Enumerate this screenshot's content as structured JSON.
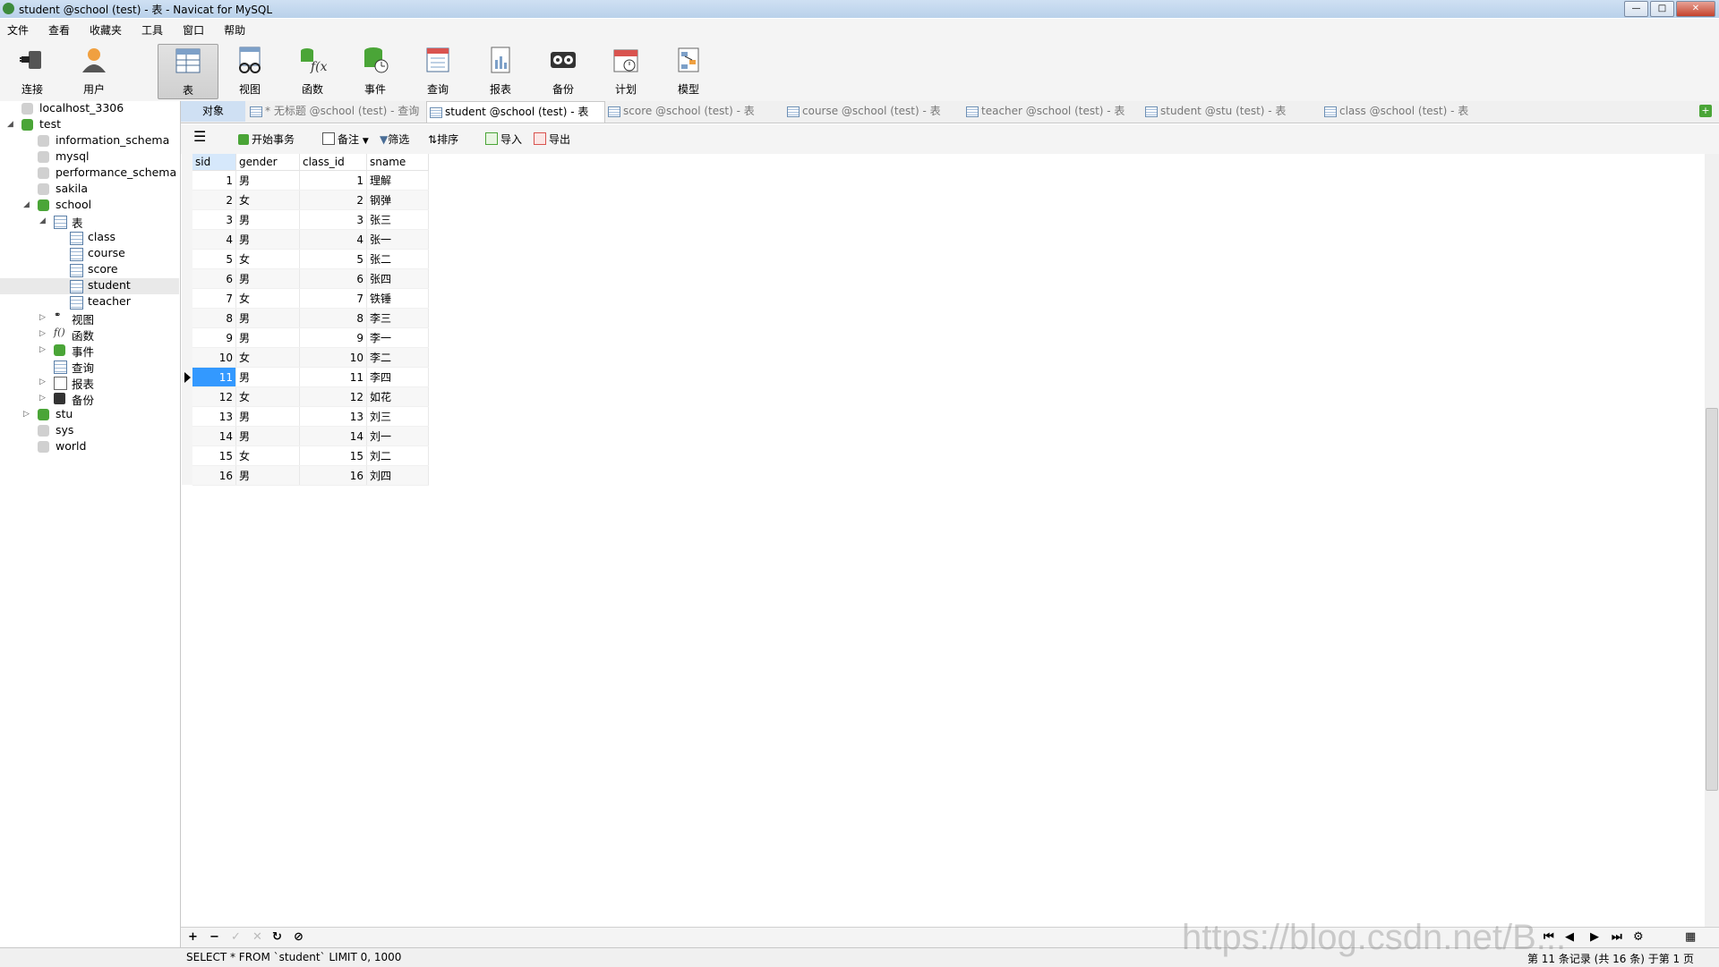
{
  "window": {
    "title": "student @school (test) - 表 - Navicat for MySQL"
  },
  "menu": [
    "文件",
    "查看",
    "收藏夹",
    "工具",
    "窗口",
    "帮助"
  ],
  "toolbar": [
    {
      "label": "连接",
      "icon": "connection-icon"
    },
    {
      "label": "用户",
      "icon": "user-icon"
    },
    {
      "label": "表",
      "icon": "table-icon",
      "active": true
    },
    {
      "label": "视图",
      "icon": "view-icon"
    },
    {
      "label": "函数",
      "icon": "function-icon"
    },
    {
      "label": "事件",
      "icon": "event-icon"
    },
    {
      "label": "查询",
      "icon": "query-icon"
    },
    {
      "label": "报表",
      "icon": "report-icon"
    },
    {
      "label": "备份",
      "icon": "backup-icon"
    },
    {
      "label": "计划",
      "icon": "schedule-icon"
    },
    {
      "label": "模型",
      "icon": "model-icon"
    }
  ],
  "tree": {
    "conn1": "localhost_3306",
    "conn2": "test",
    "dbs": [
      "information_schema",
      "mysql",
      "performance_schema",
      "sakila",
      "school"
    ],
    "tables_folder": "表",
    "tables": [
      "class",
      "course",
      "score",
      "student",
      "teacher"
    ],
    "folders": [
      "视图",
      "函数",
      "事件",
      "查询",
      "报表",
      "备份"
    ],
    "more_dbs": [
      "stu",
      "sys",
      "world"
    ]
  },
  "tabs": [
    "对象",
    "* 无标题 @school (test) - 查询",
    "student @school (test) - 表",
    "score @school (test) - 表",
    "course @school (test) - 表",
    "teacher @school (test) - 表",
    "student @stu (test) - 表",
    "class @school (test) - 表"
  ],
  "subtoolbar": {
    "begin_tx": "开始事务",
    "note": "备注",
    "filter": "筛选",
    "sort": "排序",
    "import": "导入",
    "export": "导出"
  },
  "grid": {
    "columns": [
      "sid",
      "gender",
      "class_id",
      "sname"
    ],
    "rows": [
      [
        "1",
        "男",
        "1",
        "理解"
      ],
      [
        "2",
        "女",
        "2",
        "钢弹"
      ],
      [
        "3",
        "男",
        "3",
        "张三"
      ],
      [
        "4",
        "男",
        "4",
        "张一"
      ],
      [
        "5",
        "女",
        "5",
        "张二"
      ],
      [
        "6",
        "男",
        "6",
        "张四"
      ],
      [
        "7",
        "女",
        "7",
        "铁锤"
      ],
      [
        "8",
        "男",
        "8",
        "李三"
      ],
      [
        "9",
        "男",
        "9",
        "李一"
      ],
      [
        "10",
        "女",
        "10",
        "李二"
      ],
      [
        "11",
        "男",
        "11",
        "李四"
      ],
      [
        "12",
        "女",
        "12",
        "如花"
      ],
      [
        "13",
        "男",
        "13",
        "刘三"
      ],
      [
        "14",
        "男",
        "14",
        "刘一"
      ],
      [
        "15",
        "女",
        "15",
        "刘二"
      ],
      [
        "16",
        "男",
        "16",
        "刘四"
      ]
    ],
    "selected_row_index": 10
  },
  "status": {
    "sql": "SELECT * FROM `student` LIMIT 0, 1000",
    "record": "第 11 条记录 (共 16 条) 于第 1 页"
  },
  "watermark": "https://blog.csdn.net/B..."
}
